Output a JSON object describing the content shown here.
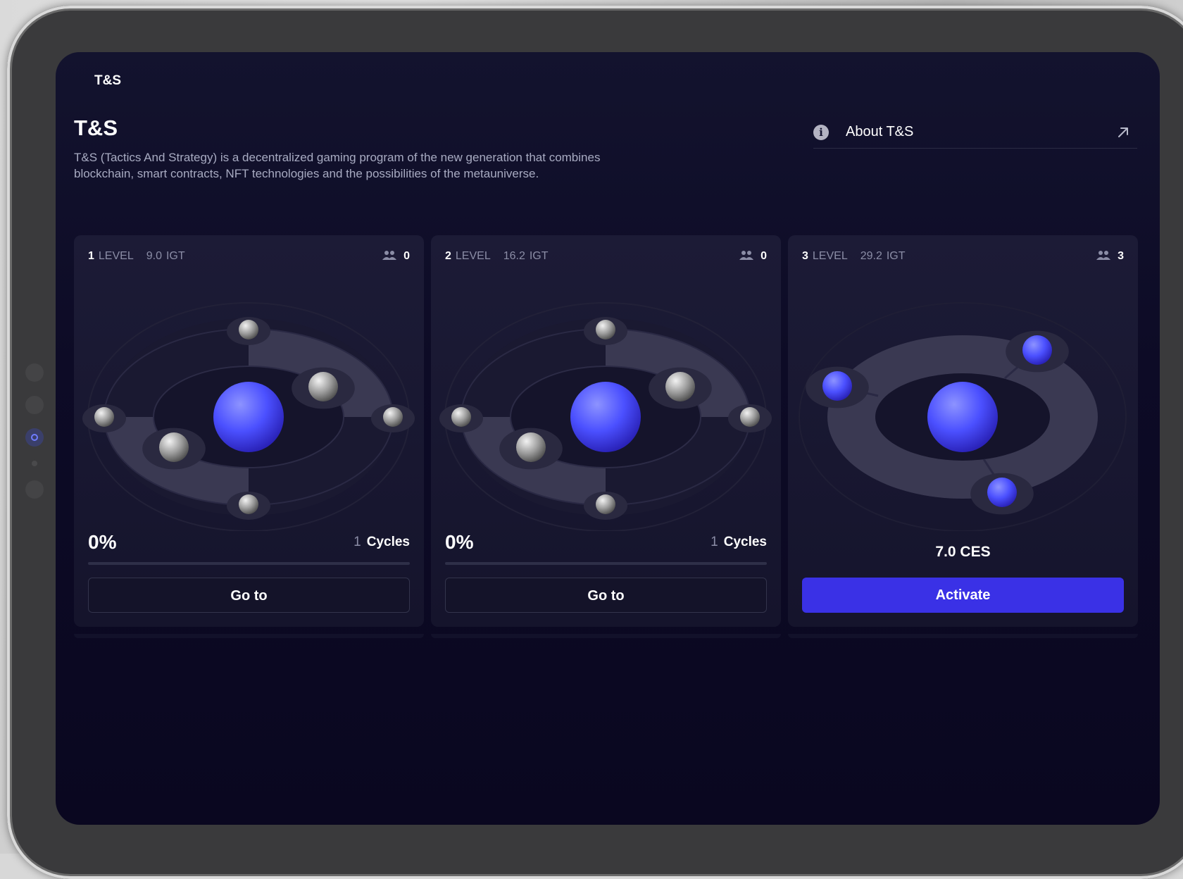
{
  "tab": {
    "label": "T&S"
  },
  "header": {
    "title": "T&S",
    "description": "T&S (Tactics And Strategy) is a decentralized gaming program of the new generation that combines blockchain, smart contracts, NFT technologies and the possibilities of the metauniverse."
  },
  "about_link": {
    "label": "About T&S",
    "icon": "info-icon",
    "arrow_icon": "external-arrow-icon"
  },
  "levels": [
    {
      "number": "1",
      "level_word": "LEVEL",
      "price": "9.0",
      "currency": "IGT",
      "partners_icon": "users-icon",
      "partners": "0",
      "progress_label": "0%",
      "progress": 0,
      "cycles_count": "1",
      "cycles_label": "Cycles",
      "button_label": "Go to",
      "active": true
    },
    {
      "number": "2",
      "level_word": "LEVEL",
      "price": "16.2",
      "currency": "IGT",
      "partners_icon": "users-icon",
      "partners": "0",
      "progress_label": "0%",
      "progress": 0,
      "cycles_count": "1",
      "cycles_label": "Cycles",
      "button_label": "Go to",
      "active": true
    },
    {
      "number": "3",
      "level_word": "LEVEL",
      "price": "29.2",
      "currency": "IGT",
      "partners_icon": "users-icon",
      "partners": "3",
      "activation_price": "7.0 CES",
      "button_label": "Activate",
      "active": false
    }
  ],
  "colors": {
    "accent": "#3a31e6",
    "screen_bg": "#0d0b26",
    "card_bg": "#1c1b36",
    "sphere_blue": "#4b50ff"
  }
}
